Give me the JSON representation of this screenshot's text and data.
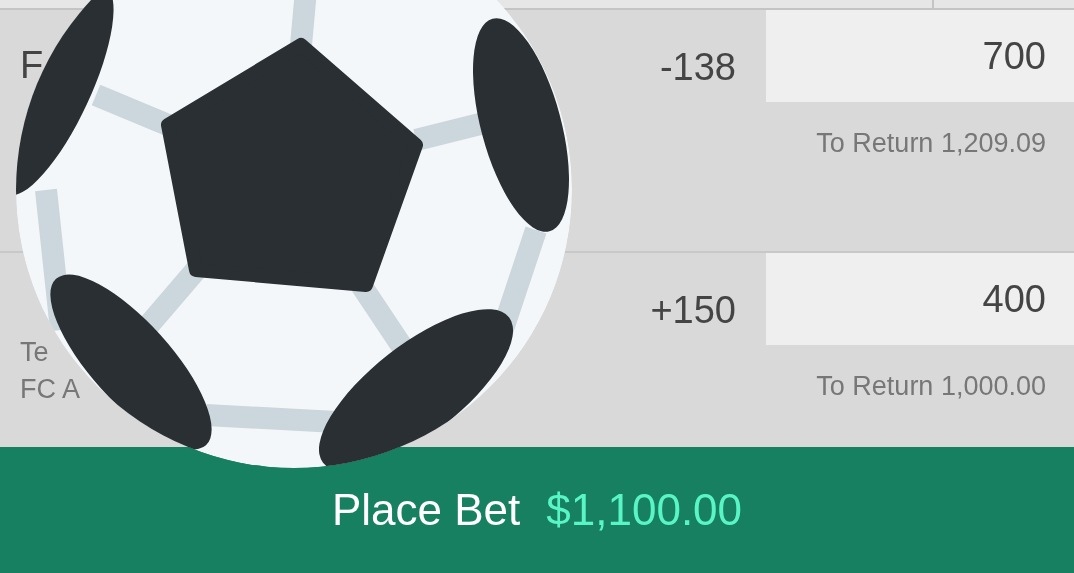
{
  "selections": [
    {
      "title": "F",
      "odds": "-138",
      "stake": "700",
      "to_return": "To Return 1,209.09"
    },
    {
      "lines": [
        "Te",
        "FC A"
      ],
      "odds": "+150",
      "stake": "400",
      "to_return": "To Return 1,000.00"
    }
  ],
  "place_bet": {
    "label": "Place Bet",
    "amount": "$1,100.00"
  }
}
